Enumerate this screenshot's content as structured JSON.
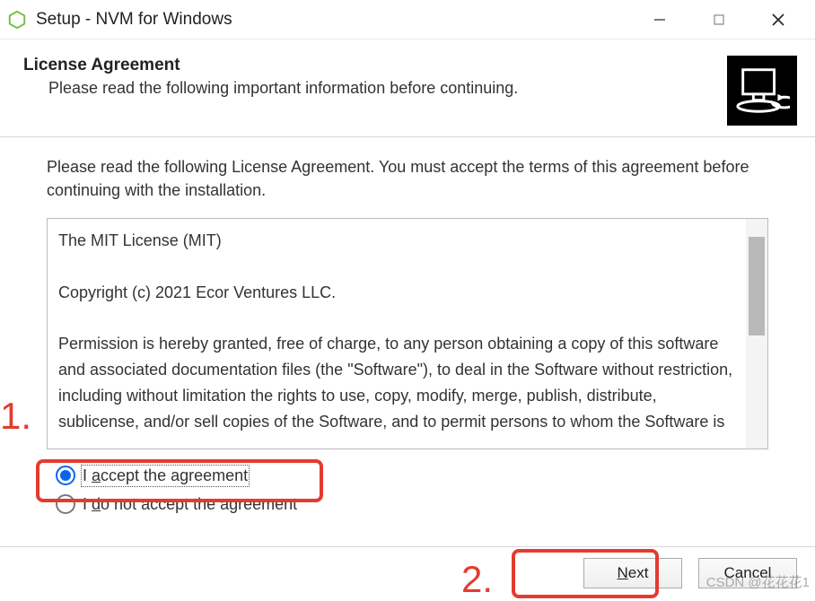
{
  "titlebar": {
    "title": "Setup - NVM for Windows",
    "icon_name": "nvm-icon"
  },
  "header": {
    "title": "License Agreement",
    "subtitle": "Please read the following important information before continuing."
  },
  "instruction": "Please read the following License Agreement. You must accept the terms of this agreement before continuing with the installation.",
  "license": {
    "line1": "The MIT License (MIT)",
    "line2": "Copyright (c) 2021 Ecor Ventures LLC.",
    "body": "Permission is hereby granted, free of charge, to any person obtaining a copy of this software and associated documentation files (the \"Software\"), to deal in the Software without restriction, including without limitation the rights to use, copy, modify, merge, publish, distribute, sublicense, and/or sell copies of the Software, and to permit persons to whom the Software is"
  },
  "radios": {
    "accept_prefix": "I ",
    "accept_uletter": "a",
    "accept_rest": "ccept the agreement",
    "reject_prefix": "I ",
    "reject_uletter": "d",
    "reject_rest": "o not accept the agreement",
    "selected": "accept"
  },
  "buttons": {
    "next_uletter": "N",
    "next_rest": "ext",
    "cancel": "Cancel"
  },
  "annotations": {
    "num1": "1.",
    "num2": "2.",
    "watermark": "CSDN @花花花1"
  }
}
